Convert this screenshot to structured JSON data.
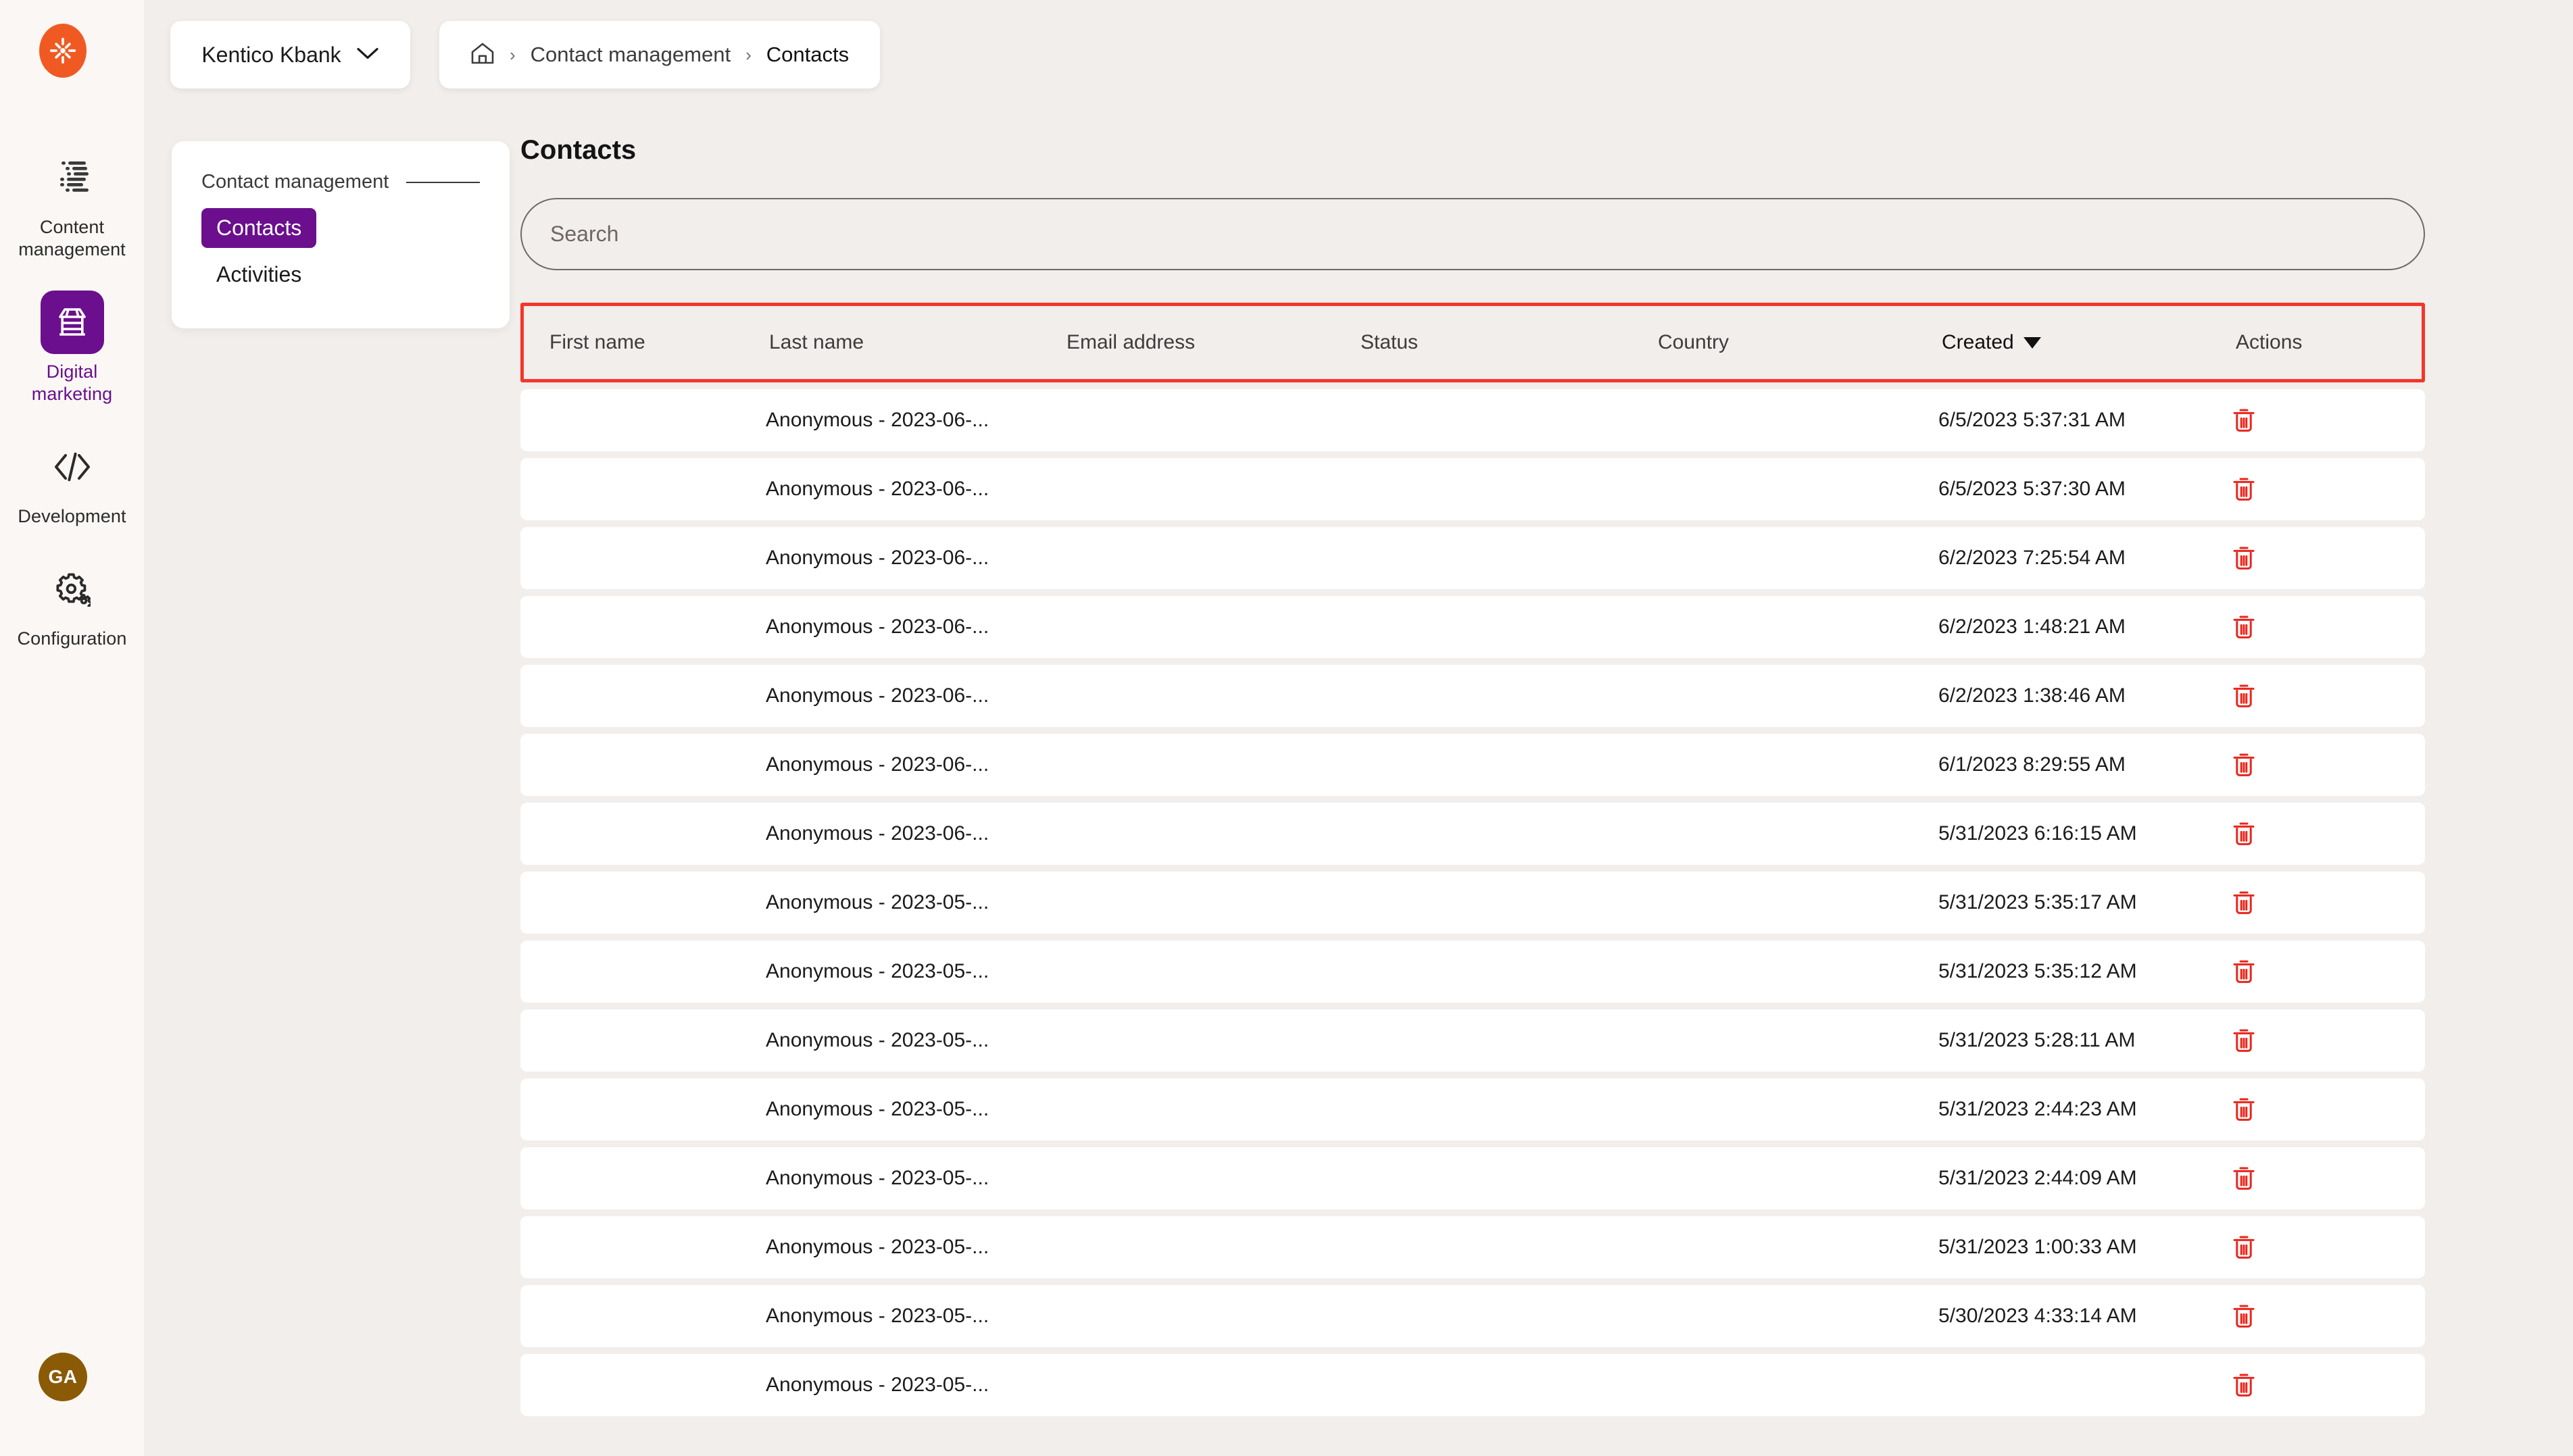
{
  "brand": {
    "logo_icon": "kentico-asterisk-logo",
    "accent_purple": "#6b0f8e",
    "accent_orange": "#f05a22",
    "highlight_red": "#f3372a"
  },
  "workspace": {
    "name": "Kentico Kbank",
    "chevron_icon": "chevron-down-icon"
  },
  "breadcrumb": {
    "home_icon": "home-icon",
    "separator": "›",
    "items": [
      {
        "label": "Contact management"
      },
      {
        "label": "Contacts"
      }
    ]
  },
  "rail": {
    "items": [
      {
        "label": "Content management",
        "icon": "content-lines-icon",
        "active": false
      },
      {
        "label": "Digital marketing",
        "icon": "storefront-icon",
        "active": true
      },
      {
        "label": "Development",
        "icon": "code-brackets-icon",
        "active": false
      },
      {
        "label": "Configuration",
        "icon": "gears-icon",
        "active": false
      }
    ],
    "avatar_initials": "GA"
  },
  "section_panel": {
    "heading": "Contact management",
    "links": [
      {
        "label": "Contacts",
        "active": true
      },
      {
        "label": "Activities",
        "active": false
      }
    ]
  },
  "main": {
    "page_title": "Contacts",
    "search": {
      "placeholder": "Search",
      "value": ""
    },
    "table": {
      "columns": [
        {
          "key": "first_name",
          "label": "First name",
          "sorted": false
        },
        {
          "key": "last_name",
          "label": "Last name",
          "sorted": false
        },
        {
          "key": "email",
          "label": "Email address",
          "sorted": false
        },
        {
          "key": "status",
          "label": "Status",
          "sorted": false
        },
        {
          "key": "country",
          "label": "Country",
          "sorted": false
        },
        {
          "key": "created",
          "label": "Created",
          "sorted": true,
          "sort_icon": "caret-down-icon"
        },
        {
          "key": "actions",
          "label": "Actions",
          "sorted": false
        }
      ],
      "delete_icon": "trash-icon",
      "rows": [
        {
          "first_name": "",
          "last_name": "Anonymous - 2023-06-...",
          "email": "",
          "status": "",
          "country": "",
          "created": "6/5/2023 5:37:31 AM"
        },
        {
          "first_name": "",
          "last_name": "Anonymous - 2023-06-...",
          "email": "",
          "status": "",
          "country": "",
          "created": "6/5/2023 5:37:30 AM"
        },
        {
          "first_name": "",
          "last_name": "Anonymous - 2023-06-...",
          "email": "",
          "status": "",
          "country": "",
          "created": "6/2/2023 7:25:54 AM"
        },
        {
          "first_name": "",
          "last_name": "Anonymous - 2023-06-...",
          "email": "",
          "status": "",
          "country": "",
          "created": "6/2/2023 1:48:21 AM"
        },
        {
          "first_name": "",
          "last_name": "Anonymous - 2023-06-...",
          "email": "",
          "status": "",
          "country": "",
          "created": "6/2/2023 1:38:46 AM"
        },
        {
          "first_name": "",
          "last_name": "Anonymous - 2023-06-...",
          "email": "",
          "status": "",
          "country": "",
          "created": "6/1/2023 8:29:55 AM"
        },
        {
          "first_name": "",
          "last_name": "Anonymous - 2023-06-...",
          "email": "",
          "status": "",
          "country": "",
          "created": "5/31/2023 6:16:15 AM"
        },
        {
          "first_name": "",
          "last_name": "Anonymous - 2023-05-...",
          "email": "",
          "status": "",
          "country": "",
          "created": "5/31/2023 5:35:17 AM"
        },
        {
          "first_name": "",
          "last_name": "Anonymous - 2023-05-...",
          "email": "",
          "status": "",
          "country": "",
          "created": "5/31/2023 5:35:12 AM"
        },
        {
          "first_name": "",
          "last_name": "Anonymous - 2023-05-...",
          "email": "",
          "status": "",
          "country": "",
          "created": "5/31/2023 5:28:11 AM"
        },
        {
          "first_name": "",
          "last_name": "Anonymous - 2023-05-...",
          "email": "",
          "status": "",
          "country": "",
          "created": "5/31/2023 2:44:23 AM"
        },
        {
          "first_name": "",
          "last_name": "Anonymous - 2023-05-...",
          "email": "",
          "status": "",
          "country": "",
          "created": "5/31/2023 2:44:09 AM"
        },
        {
          "first_name": "",
          "last_name": "Anonymous - 2023-05-...",
          "email": "",
          "status": "",
          "country": "",
          "created": "5/31/2023 1:00:33 AM"
        },
        {
          "first_name": "",
          "last_name": "Anonymous - 2023-05-...",
          "email": "",
          "status": "",
          "country": "",
          "created": "5/30/2023 4:33:14 AM"
        },
        {
          "first_name": "",
          "last_name": "Anonymous - 2023-05-...",
          "email": "",
          "status": "",
          "country": "",
          "created": ""
        }
      ]
    }
  }
}
